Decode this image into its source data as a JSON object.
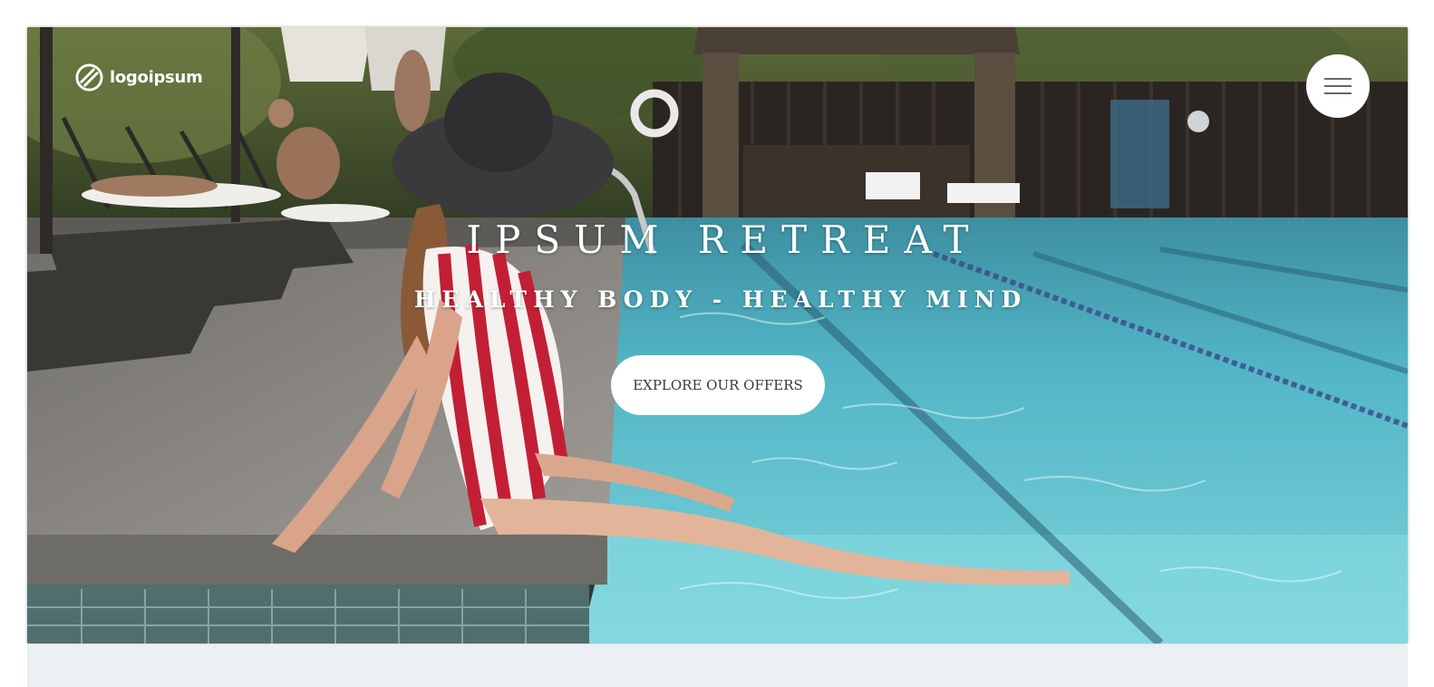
{
  "brand": {
    "name": "logoipsum",
    "icon": "logoipsum-mark-icon"
  },
  "nav": {
    "menu_icon": "hamburger-menu-icon"
  },
  "hero": {
    "title": "IPSUM RETREAT",
    "subtitle": "HEALTHY BODY - HEALTHY MIND",
    "cta_label": "EXPLORE OUR OFFERS",
    "background": "pool-scene-photo"
  },
  "colors": {
    "pool_water": "#3fb3c4",
    "deck": "#8e8b86",
    "button_bg": "#ffffff",
    "button_text": "#3a3a3a",
    "below_strip": "#eceff3"
  }
}
